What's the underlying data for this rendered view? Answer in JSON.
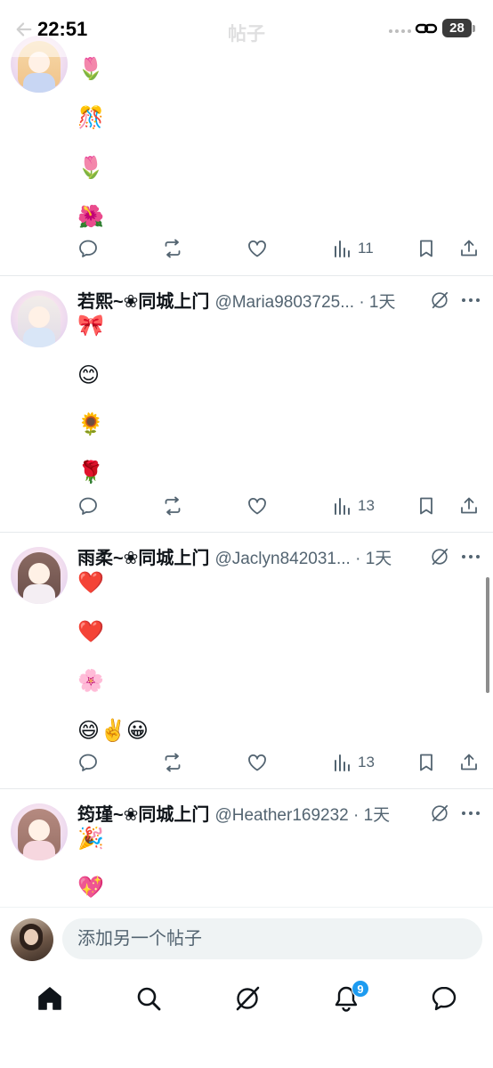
{
  "status_bar": {
    "time": "22:51",
    "battery": "28",
    "nav_title": "帖子"
  },
  "icons": {
    "back": "back-arrow-icon",
    "reply": "reply-icon",
    "repost": "repost-icon",
    "like": "heart-icon",
    "views": "views-chart-icon",
    "bookmark": "bookmark-icon",
    "share": "share-icon",
    "grok": "grok-icon",
    "more": "more-icon"
  },
  "colors": {
    "text_primary": "#0f1419",
    "text_secondary": "#536471",
    "accent": "#1d9bf0",
    "divider": "#e6e9ec"
  },
  "posts": [
    {
      "display_name": "",
      "handle": "",
      "emoji_lines": [
        "🌷",
        "🎊",
        "🌷",
        "🌺"
      ],
      "views": "11"
    },
    {
      "display_name": "若熙~❀同城上门",
      "handle": "@Maria9803725... · 1天",
      "emoji_lines": [
        "🎀",
        "😊",
        "🌻",
        "🌹"
      ],
      "views": "13"
    },
    {
      "display_name": "雨柔~❀同城上门",
      "handle": "@Jaclyn842031... · 1天",
      "emoji_lines": [
        "❤️",
        "❤️",
        "🌸",
        "😄✌️😀"
      ],
      "views": "13"
    },
    {
      "display_name": "筠瑾~❀同城上门",
      "handle": "@Heather169232 · 1天",
      "emoji_lines": [
        "🎉",
        "💖"
      ],
      "views": ""
    }
  ],
  "compose": {
    "placeholder": "添加另一个帖子"
  },
  "bottom_nav": {
    "items": [
      "home-icon",
      "search-icon",
      "grok-icon",
      "notifications-icon",
      "messages-icon"
    ],
    "notification_count": "9"
  }
}
